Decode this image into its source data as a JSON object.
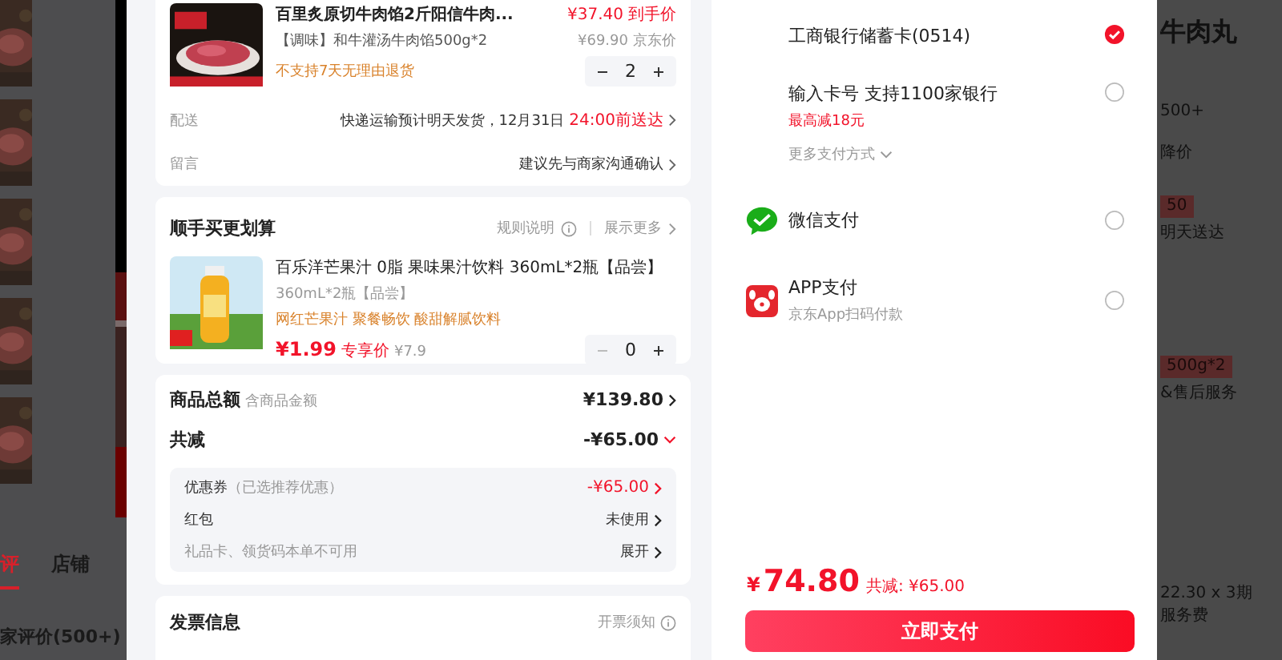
{
  "background_left": {
    "tabs": [
      {
        "label": "评",
        "selected": true
      },
      {
        "label": "店铺",
        "selected": false
      }
    ],
    "review_heading": "家评价(500+)"
  },
  "order": {
    "product": {
      "title": "百里炙原切牛肉馅2斤阳信牛肉...",
      "price": "¥37.40",
      "price_note": "到手价",
      "spec": "【调味】和牛灌汤牛肉馅500g*2",
      "original_price": "¥69.90",
      "original_note": "京东价",
      "notice": "不支持7天无理由退货",
      "quantity": "2"
    },
    "rows": [
      {
        "label": "配送",
        "value": "快递运输预计明天发货，12月31日",
        "highlight": "24:00前送达"
      },
      {
        "label": "留言",
        "value": "建议先与商家沟通确认"
      }
    ]
  },
  "addon": {
    "title": "顺手买更划算",
    "rules": "规则说明",
    "more": "展示更多",
    "product": {
      "title": "百乐洋芒果汁 0脂 果味果汁饮料 360mL*2瓶【品尝】",
      "spec": "360mL*2瓶【品尝】",
      "slogan": "网红芒果汁 聚餐畅饮 酸甜解腻饮料",
      "price": "¥1.99",
      "price_note": "专享价",
      "original_price": "¥7.9",
      "quantity": "0"
    }
  },
  "summary": {
    "total_label": "商品总额",
    "total_note": "含商品金额",
    "total": "¥139.80",
    "discount_label": "共减",
    "discount": "-¥65.00",
    "details": [
      {
        "kind": "discount",
        "label": "优惠券",
        "note": "（已选推荐优惠）",
        "value": "-¥65.00"
      },
      {
        "kind": "normal",
        "label": "红包",
        "value": "未使用"
      },
      {
        "kind": "muted",
        "label": "礼品卡、领货码本单不可用",
        "value": "展开"
      }
    ]
  },
  "invoice": {
    "title": "发票信息",
    "note": "开票须知"
  },
  "payment": {
    "methods": [
      {
        "kind": "bank",
        "title": "工商银行储蓄卡(0514)",
        "selected": true
      },
      {
        "kind": "bank",
        "title": "输入卡号 支持1100家银行",
        "promo": "最高减18元",
        "selected": false
      },
      {
        "kind": "wechat",
        "title": "微信支付",
        "selected": false
      },
      {
        "kind": "app",
        "title": "APP支付",
        "subtitle": "京东App扫码付款",
        "selected": false
      }
    ],
    "more": "更多支付方式",
    "currency": "¥",
    "total": "74.80",
    "saved": "共减: ¥65.00",
    "button": "立即支付"
  },
  "background_right": {
    "texts": [
      {
        "kind": "title",
        "text": "牛肉丸"
      },
      {
        "kind": "plain",
        "text": "500+"
      },
      {
        "kind": "plain",
        "text": "降价"
      },
      {
        "kind": "tag",
        "text": "50"
      },
      {
        "kind": "plain",
        "text": "明天送达"
      },
      {
        "kind": "tag",
        "text": "500g*2"
      },
      {
        "kind": "plain",
        "text": "&售后服务"
      },
      {
        "kind": "plain",
        "text": "22.30 x 3期"
      },
      {
        "kind": "plain",
        "text": "服务费"
      }
    ]
  }
}
